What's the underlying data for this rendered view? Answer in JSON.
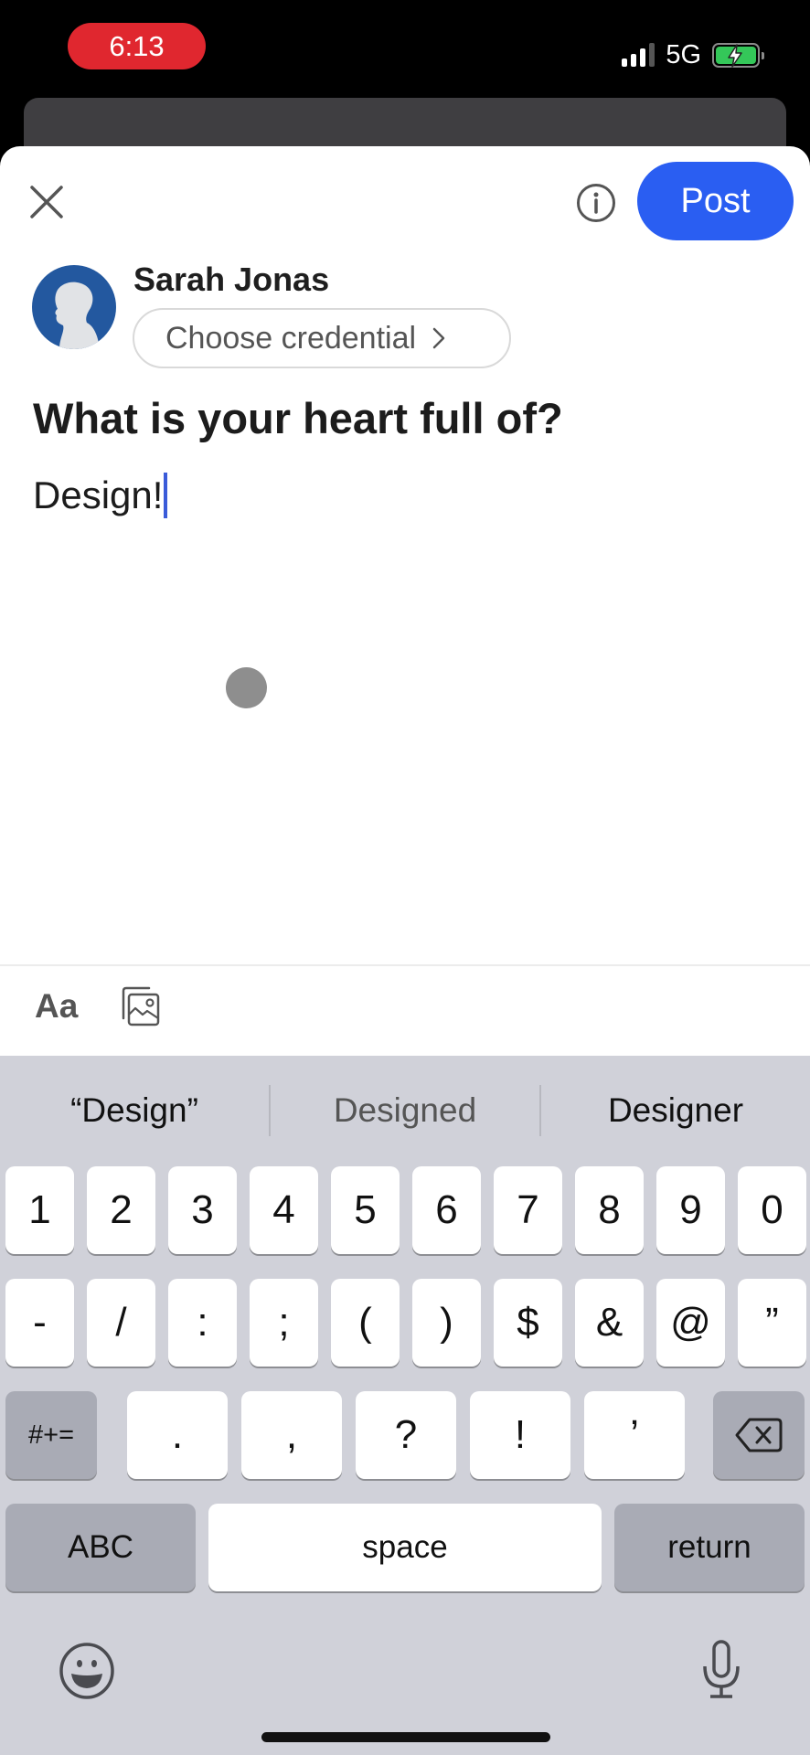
{
  "status_bar": {
    "time": "6:13",
    "network": "5G",
    "signal_bars_active": 3,
    "signal_bars_total": 4,
    "battery_charging": true,
    "time_pill_color": "#e0272f",
    "battery_color": "#34c759"
  },
  "composer": {
    "close_icon": "close-icon",
    "info_icon": "info-icon",
    "post_label": "Post",
    "post_color": "#2a5ef2",
    "author_name": "Sarah Jonas",
    "credential_label": "Choose credential",
    "prompt_title": "What is your heart full of?",
    "text_value": "Design!"
  },
  "toolbar": {
    "format_label": "Aa",
    "media_icon": "image-gallery-icon"
  },
  "keyboard": {
    "suggestions": [
      "“Design”",
      "Designed",
      "Designer"
    ],
    "row1": [
      "1",
      "2",
      "3",
      "4",
      "5",
      "6",
      "7",
      "8",
      "9",
      "0"
    ],
    "row2": [
      "-",
      "/",
      ":",
      ";",
      "(",
      ")",
      "$",
      "&",
      "@",
      "”"
    ],
    "row3_toggle": "#+=",
    "row3": [
      ".",
      ",",
      "?",
      "!",
      "’"
    ],
    "abc_label": "ABC",
    "space_label": "space",
    "return_label": "return",
    "emoji_icon": "emoji-icon",
    "mic_icon": "microphone-icon"
  }
}
